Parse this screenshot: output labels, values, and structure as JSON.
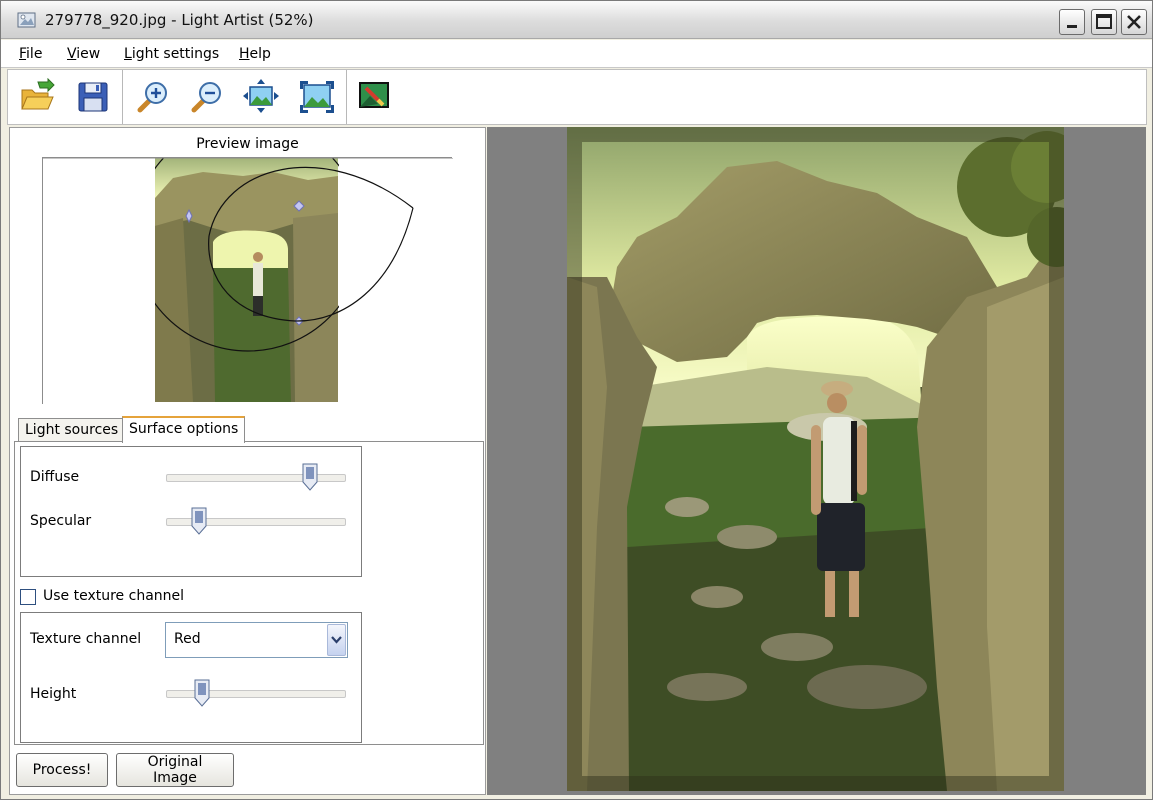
{
  "window": {
    "title": "279778_920.jpg - Light Artist (52%)",
    "icons": [
      "app-icon",
      "minimize-icon",
      "maximize-icon",
      "close-icon"
    ]
  },
  "menu": {
    "file": {
      "underline": "F",
      "rest": "ile"
    },
    "view": {
      "underline": "V",
      "rest": "iew"
    },
    "light_settings": {
      "underline": "L",
      "rest": "ight settings"
    },
    "help": {
      "underline": "H",
      "rest": "elp"
    }
  },
  "toolbar": {
    "buttons": [
      "open-folder-icon",
      "save-icon",
      "zoom-in-icon",
      "zoom-out-icon",
      "fit-to-window-icon",
      "actual-size-icon",
      "edit-image-icon"
    ]
  },
  "preview": {
    "title": "Preview image"
  },
  "tabs": {
    "light_sources": "Light sources",
    "surface_options": "Surface options",
    "active": "surface_options"
  },
  "surface": {
    "diffuse_label": "Diffuse",
    "diffuse_value": 0.8,
    "specular_label": "Specular",
    "specular_value": 0.19,
    "use_texture_label": "Use texture channel",
    "use_texture_checked": false,
    "texture_channel_label": "Texture channel",
    "texture_channel_value": "Red",
    "height_label": "Height",
    "height_value": 0.21
  },
  "buttons": {
    "process": "Process!",
    "original": "Original Image"
  },
  "colors": {
    "tab_accent": "#e5a33b",
    "image_background": "#808080"
  }
}
